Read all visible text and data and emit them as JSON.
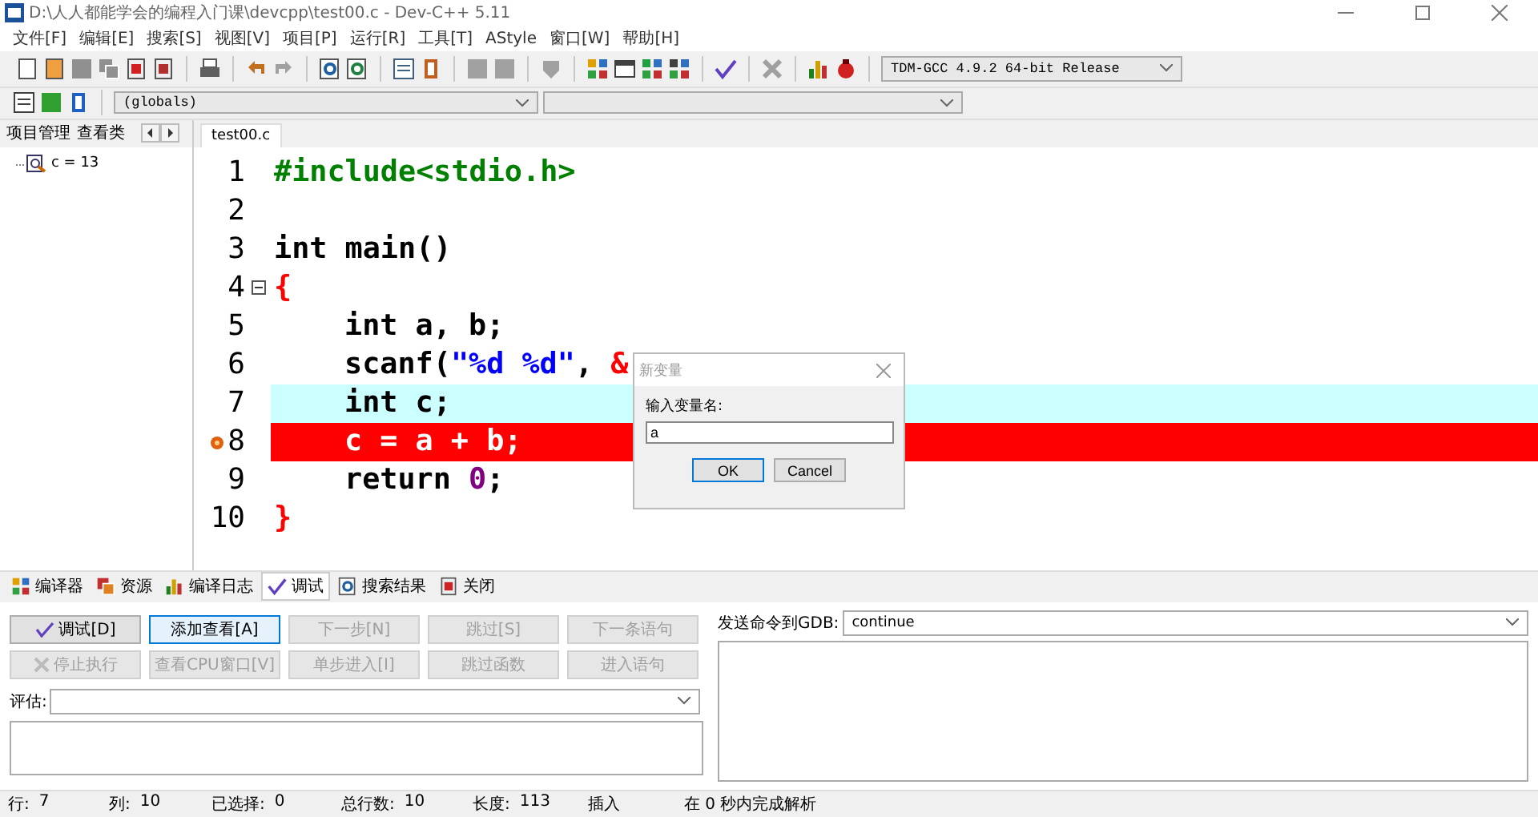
{
  "window": {
    "title": "D:\\人人都能学会的编程入门课\\devcpp\\test00.c - Dev-C++ 5.11"
  },
  "menu": [
    "文件[F]",
    "编辑[E]",
    "搜索[S]",
    "视图[V]",
    "项目[P]",
    "运行[R]",
    "工具[T]",
    "AStyle",
    "窗口[W]",
    "帮助[H]"
  ],
  "compiler_select": {
    "value": "TDM-GCC 4.9.2 64-bit Release"
  },
  "scope_select": {
    "value": "(globals)"
  },
  "left_panel": {
    "tabs": [
      {
        "label": "项目管理",
        "selected": false
      },
      {
        "label": "查看类",
        "selected": false
      }
    ],
    "watch_items": [
      {
        "label": "c = 13"
      }
    ]
  },
  "editor": {
    "tab": "test00.c",
    "lines": [
      {
        "num": "1",
        "active": false,
        "breakpoint": false,
        "fold": false,
        "indented": false,
        "segments": [
          {
            "text": "#include<stdio.h>",
            "kind": "preprocessor"
          }
        ]
      },
      {
        "num": "2",
        "active": false,
        "breakpoint": false,
        "fold": false
      },
      {
        "num": "3",
        "active": false,
        "breakpoint": false,
        "fold": false,
        "indented": false,
        "segments": [
          {
            "text": "int",
            "kind": "keyword"
          },
          {
            "text": " main()",
            "kind": "plain"
          }
        ]
      },
      {
        "num": "4",
        "active": false,
        "breakpoint": false,
        "fold": true,
        "indented": false,
        "segments": [
          {
            "text": "{",
            "kind": "symbol"
          }
        ]
      },
      {
        "num": "5",
        "active": false,
        "breakpoint": false,
        "fold": false,
        "indented": true,
        "segments": [
          {
            "text": "int",
            "kind": "keyword"
          },
          {
            "text": " a, b;",
            "kind": "plain"
          }
        ]
      },
      {
        "num": "6",
        "active": false,
        "breakpoint": false,
        "fold": false,
        "indented": true,
        "segments": [
          {
            "text": "scanf(",
            "kind": "plain"
          },
          {
            "text": "\"%d %d\"",
            "kind": "string"
          },
          {
            "text": ", ",
            "kind": "plain"
          },
          {
            "text": "&",
            "kind": "symbol"
          }
        ]
      },
      {
        "num": "7",
        "active": true,
        "breakpoint": false,
        "fold": false,
        "indented": true,
        "segments": [
          {
            "text": "int",
            "kind": "keyword"
          },
          {
            "text": " c;",
            "kind": "plain"
          }
        ]
      },
      {
        "num": "8",
        "active": false,
        "breakpoint": true,
        "fold": false,
        "indented": true,
        "segments": [
          {
            "text": "c = a + b;",
            "kind": "plain"
          }
        ]
      },
      {
        "num": "9",
        "active": false,
        "breakpoint": false,
        "fold": false,
        "indented": true,
        "segments": [
          {
            "text": "return ",
            "kind": "plain"
          },
          {
            "text": "0",
            "kind": "number"
          },
          {
            "text": ";",
            "kind": "plain"
          }
        ]
      },
      {
        "num": "10",
        "active": false,
        "breakpoint": false,
        "fold": false,
        "indented": false,
        "segments": [
          {
            "text": "}",
            "kind": "symbol"
          }
        ]
      }
    ]
  },
  "dialog": {
    "title": "新变量",
    "label": "输入变量名:",
    "value": "a",
    "buttons": [
      {
        "label": "OK",
        "default": true
      },
      {
        "label": "Cancel",
        "default": false
      }
    ]
  },
  "bottom_tabs": [
    {
      "label": "编译器",
      "selected": false
    },
    {
      "label": "资源",
      "selected": false
    },
    {
      "label": "编译日志",
      "selected": false
    },
    {
      "label": "调试",
      "selected": true
    },
    {
      "label": "搜索结果",
      "selected": false
    },
    {
      "label": "关闭",
      "selected": false
    }
  ],
  "debug": {
    "buttons": [
      {
        "label": "调试[D]",
        "disabled": false,
        "focused": false
      },
      {
        "label": "添加查看[A]",
        "disabled": false,
        "focused": true
      },
      {
        "label": "下一步[N]",
        "disabled": true,
        "focused": false
      },
      {
        "label": "跳过[S]",
        "disabled": true,
        "focused": false
      },
      {
        "label": "下一条语句",
        "disabled": true,
        "focused": false
      },
      {
        "label": "停止执行",
        "disabled": true,
        "focused": false
      },
      {
        "label": "查看CPU窗口[V]",
        "disabled": true,
        "focused": false
      },
      {
        "label": "单步进入[I]",
        "disabled": true,
        "focused": false
      },
      {
        "label": "跳过函数",
        "disabled": true,
        "focused": false
      },
      {
        "label": "进入语句",
        "disabled": true,
        "focused": false
      }
    ],
    "evaluate_label": "评估:",
    "gdb_label": "发送命令到GDB:",
    "gdb_command": "continue"
  },
  "status_bar": [
    {
      "label": "行:",
      "value": "7"
    },
    {
      "label": "列:",
      "value": "10"
    },
    {
      "label": "已选择:",
      "value": "0"
    },
    {
      "label": "总行数:",
      "value": "10"
    },
    {
      "label": "长度:",
      "value": "113"
    },
    {
      "label": "插入"
    },
    {
      "label": "在 0 秒内完成解析"
    }
  ]
}
